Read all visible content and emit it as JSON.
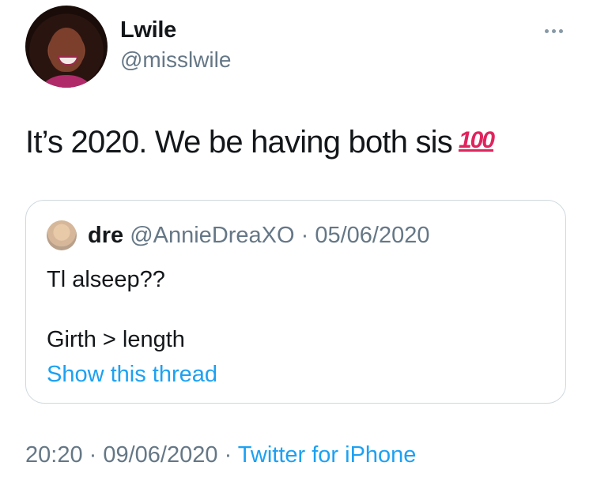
{
  "author": {
    "name": "Lwile",
    "handle": "@misslwile"
  },
  "tweet": {
    "text": "It’s 2020. We be having both sis",
    "emoji": "💯",
    "emoji_icon": "hundred-points-icon",
    "emoji_fallback": "100"
  },
  "quoted": {
    "name": "dre",
    "handle": "@AnnieDreaXO",
    "separator": " · ",
    "date": "05/06/2020",
    "line1": "Tl alseep??",
    "line2": "Girth > length",
    "show_thread": "Show this thread"
  },
  "footer": {
    "time": "20:20",
    "dot": " · ",
    "date": "09/06/2020",
    "source": "Twitter for iPhone"
  },
  "colors": {
    "link": "#1da1f2",
    "muted": "#657786",
    "text": "#14171a",
    "border": "#cfd9de"
  }
}
